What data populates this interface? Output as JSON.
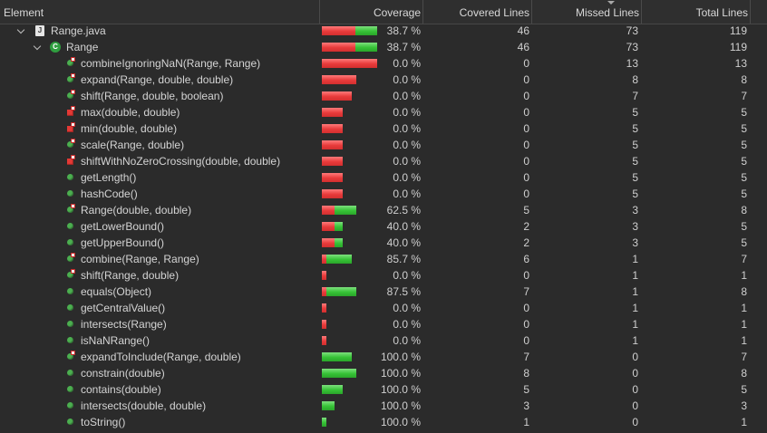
{
  "header": {
    "element": "Element",
    "coverage": "Coverage",
    "covered": "Covered Lines",
    "missed": "Missed Lines",
    "total": "Total Lines"
  },
  "rows": [
    {
      "name": "Range.java",
      "level": 0,
      "kind": "file",
      "expanded": true,
      "coverage": "38.7 %",
      "covered": "46",
      "missed": "73",
      "total": "119"
    },
    {
      "name": "Range",
      "level": 1,
      "kind": "class",
      "expanded": true,
      "coverage": "38.7 %",
      "covered": "46",
      "missed": "73",
      "total": "119"
    },
    {
      "name": "combineIgnoringNaN(Range, Range)",
      "level": 2,
      "kind": "static",
      "coverage": "0.0 %",
      "covered": "0",
      "missed": "13",
      "total": "13"
    },
    {
      "name": "expand(Range, double, double)",
      "level": 2,
      "kind": "static",
      "coverage": "0.0 %",
      "covered": "0",
      "missed": "8",
      "total": "8"
    },
    {
      "name": "shift(Range, double, boolean)",
      "level": 2,
      "kind": "static",
      "coverage": "0.0 %",
      "covered": "0",
      "missed": "7",
      "total": "7"
    },
    {
      "name": "max(double, double)",
      "level": 2,
      "kind": "private-static",
      "coverage": "0.0 %",
      "covered": "0",
      "missed": "5",
      "total": "5"
    },
    {
      "name": "min(double, double)",
      "level": 2,
      "kind": "private-static",
      "coverage": "0.0 %",
      "covered": "0",
      "missed": "5",
      "total": "5"
    },
    {
      "name": "scale(Range, double)",
      "level": 2,
      "kind": "static",
      "coverage": "0.0 %",
      "covered": "0",
      "missed": "5",
      "total": "5"
    },
    {
      "name": "shiftWithNoZeroCrossing(double, double)",
      "level": 2,
      "kind": "private-static",
      "coverage": "0.0 %",
      "covered": "0",
      "missed": "5",
      "total": "5"
    },
    {
      "name": "getLength()",
      "level": 2,
      "kind": "public",
      "coverage": "0.0 %",
      "covered": "0",
      "missed": "5",
      "total": "5"
    },
    {
      "name": "hashCode()",
      "level": 2,
      "kind": "public",
      "coverage": "0.0 %",
      "covered": "0",
      "missed": "5",
      "total": "5"
    },
    {
      "name": "Range(double, double)",
      "level": 2,
      "kind": "constructor",
      "coverage": "62.5 %",
      "covered": "5",
      "missed": "3",
      "total": "8"
    },
    {
      "name": "getLowerBound()",
      "level": 2,
      "kind": "public",
      "coverage": "40.0 %",
      "covered": "2",
      "missed": "3",
      "total": "5"
    },
    {
      "name": "getUpperBound()",
      "level": 2,
      "kind": "public",
      "coverage": "40.0 %",
      "covered": "2",
      "missed": "3",
      "total": "5"
    },
    {
      "name": "combine(Range, Range)",
      "level": 2,
      "kind": "static",
      "coverage": "85.7 %",
      "covered": "6",
      "missed": "1",
      "total": "7"
    },
    {
      "name": "shift(Range, double)",
      "level": 2,
      "kind": "static",
      "coverage": "0.0 %",
      "covered": "0",
      "missed": "1",
      "total": "1"
    },
    {
      "name": "equals(Object)",
      "level": 2,
      "kind": "public",
      "coverage": "87.5 %",
      "covered": "7",
      "missed": "1",
      "total": "8"
    },
    {
      "name": "getCentralValue()",
      "level": 2,
      "kind": "public",
      "coverage": "0.0 %",
      "covered": "0",
      "missed": "1",
      "total": "1"
    },
    {
      "name": "intersects(Range)",
      "level": 2,
      "kind": "public",
      "coverage": "0.0 %",
      "covered": "0",
      "missed": "1",
      "total": "1"
    },
    {
      "name": "isNaNRange()",
      "level": 2,
      "kind": "public",
      "coverage": "0.0 %",
      "covered": "0",
      "missed": "1",
      "total": "1"
    },
    {
      "name": "expandToInclude(Range, double)",
      "level": 2,
      "kind": "static",
      "coverage": "100.0 %",
      "covered": "7",
      "missed": "0",
      "total": "7"
    },
    {
      "name": "constrain(double)",
      "level": 2,
      "kind": "public",
      "coverage": "100.0 %",
      "covered": "8",
      "missed": "0",
      "total": "8"
    },
    {
      "name": "contains(double)",
      "level": 2,
      "kind": "public",
      "coverage": "100.0 %",
      "covered": "5",
      "missed": "0",
      "total": "5"
    },
    {
      "name": "intersects(double, double)",
      "level": 2,
      "kind": "public",
      "coverage": "100.0 %",
      "covered": "3",
      "missed": "0",
      "total": "3"
    },
    {
      "name": "toString()",
      "level": 2,
      "kind": "public",
      "coverage": "100.0 %",
      "covered": "1",
      "missed": "0",
      "total": "1"
    }
  ],
  "colors": {
    "covered": "#36c236",
    "missed": "#e83b3b",
    "background": "#2b2b2b"
  }
}
